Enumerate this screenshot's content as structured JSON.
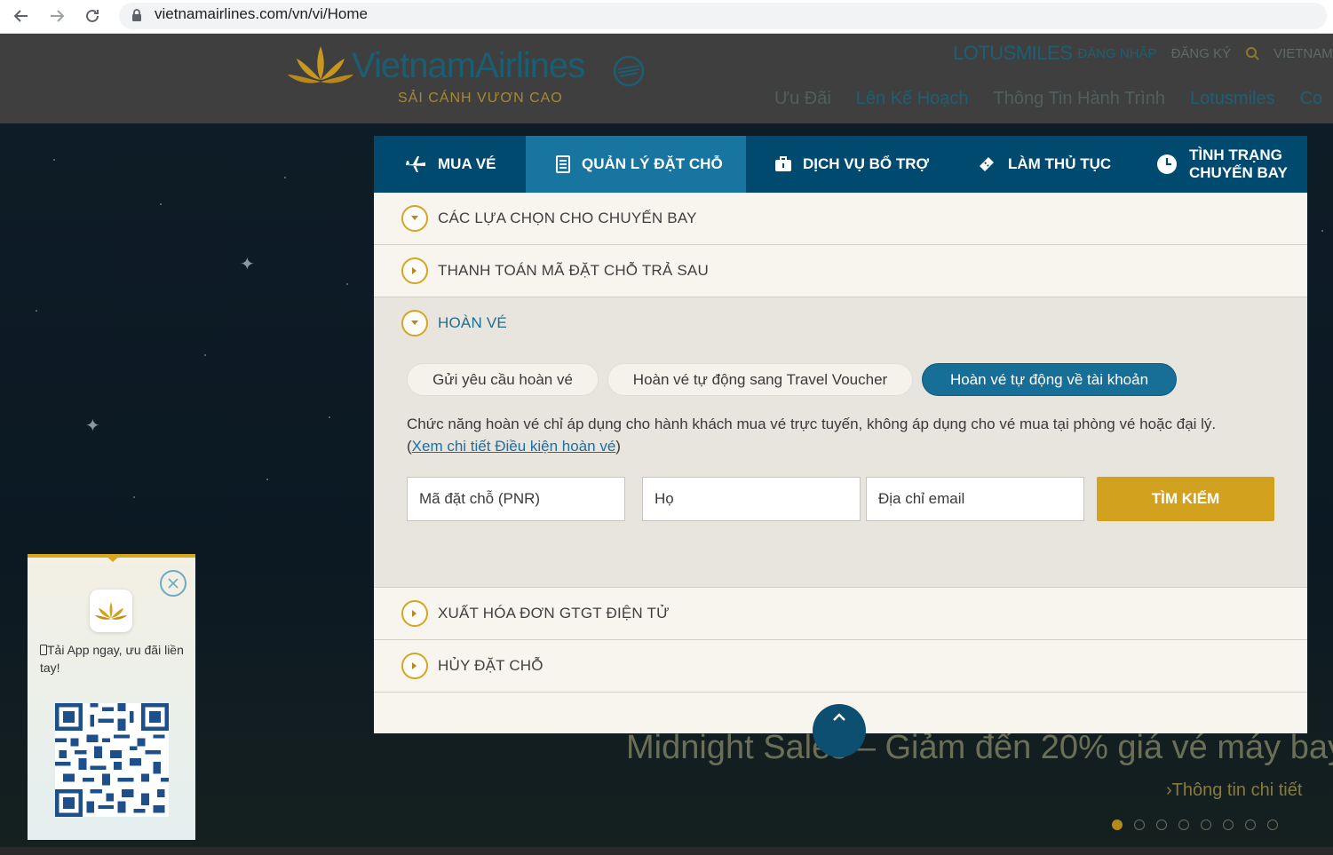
{
  "browser": {
    "url": "vietnamairlines.com/vn/vi/Home"
  },
  "header": {
    "logo_text": "VietnamAirlines",
    "logo_tagline": "SẢI CÁNH VƯƠN CAO",
    "top_links": {
      "lotusmiles": "LOTUSMILES",
      "login": "ĐĂNG NHẬP",
      "register": "ĐĂNG KÝ",
      "region": "VIETNAM - T"
    },
    "nav": [
      "Ưu Đãi",
      "Lên Kế Hoạch",
      "Thông Tin Hành Trình",
      "Lotusmiles",
      "Co"
    ]
  },
  "widget": {
    "tabs": [
      {
        "label": "MUA VÉ",
        "icon": "airplane-icon"
      },
      {
        "label": "QUẢN LÝ ĐẶT CHỖ",
        "icon": "booking-document-icon"
      },
      {
        "label": "DỊCH VỤ BỔ TRỢ",
        "icon": "luggage-icon"
      },
      {
        "label": "LÀM THỦ TỤC",
        "icon": "boarding-ticket-icon"
      },
      {
        "label": "TÌNH TRẠNG CHUYẾN BAY",
        "icon": "clock-icon"
      }
    ],
    "active_tab": 1,
    "sections": {
      "flight_options": "CÁC LỰA CHỌN CHO CHUYẾN BAY",
      "pay_later": "THANH TOÁN MÃ ĐẶT CHỖ TRẢ SAU",
      "refund": "HOÀN VÉ",
      "invoice": "XUẤT HÓA ĐƠN GTGT ĐIỆN TỬ",
      "cancel": "HỦY ĐẶT CHỖ"
    },
    "refund_options": [
      "Gửi yêu cầu hoàn vé",
      "Hoàn vé tự động sang Travel Voucher",
      "Hoàn vé tự động về tài khoản"
    ],
    "active_refund_option": 2,
    "notice_line1": "Chức năng hoàn vé chỉ áp dụng cho hành khách mua vé trực tuyến, không áp dụng cho vé mua tại phòng vé hoặc đại lý.",
    "notice_open": "(",
    "notice_link": "Xem chi tiết Điều kiện hoàn vé",
    "notice_close": ")",
    "fields": {
      "pnr_placeholder": "Mã đặt chỗ (PNR)",
      "lastname_placeholder": "Họ",
      "email_placeholder": "Địa chỉ email"
    },
    "search_button": "TÌM KIẾM"
  },
  "promo": {
    "title": "Midnight Sales – Giảm đến 20% giá vé máy bay",
    "link": "›Thông tin chi tiết",
    "carousel_count": 8,
    "carousel_active": 0
  },
  "app_popup": {
    "text": "Tải App ngay, ưu đãi liền tay!"
  },
  "colors": {
    "brand_blue": "#004a6f",
    "active_blue": "#1775a0",
    "gold": "#d2a11e"
  }
}
